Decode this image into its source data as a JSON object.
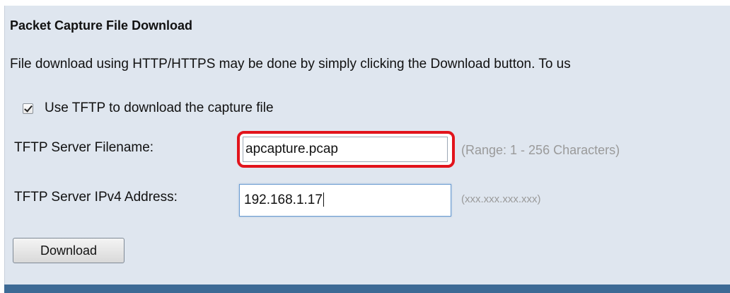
{
  "section": {
    "title": "Packet Capture File Download",
    "description": "File download using HTTP/HTTPS may be done by simply clicking the Download button. To us"
  },
  "tftp_option": {
    "checked": true,
    "label": "Use TFTP to download the capture file"
  },
  "fields": {
    "filename": {
      "label": "TFTP Server Filename:",
      "value": "apcapture.pcap",
      "hint": "(Range: 1 - 256 Characters)",
      "highlight_color": "#e2141c"
    },
    "ipv4": {
      "label": "TFTP Server IPv4 Address:",
      "value": "192.168.1.17",
      "hint": "(xxx.xxx.xxx.xxx)"
    }
  },
  "actions": {
    "download_label": "Download"
  },
  "colors": {
    "panel_bg": "#dfe6ef",
    "footer_bar": "#3d6a95"
  }
}
